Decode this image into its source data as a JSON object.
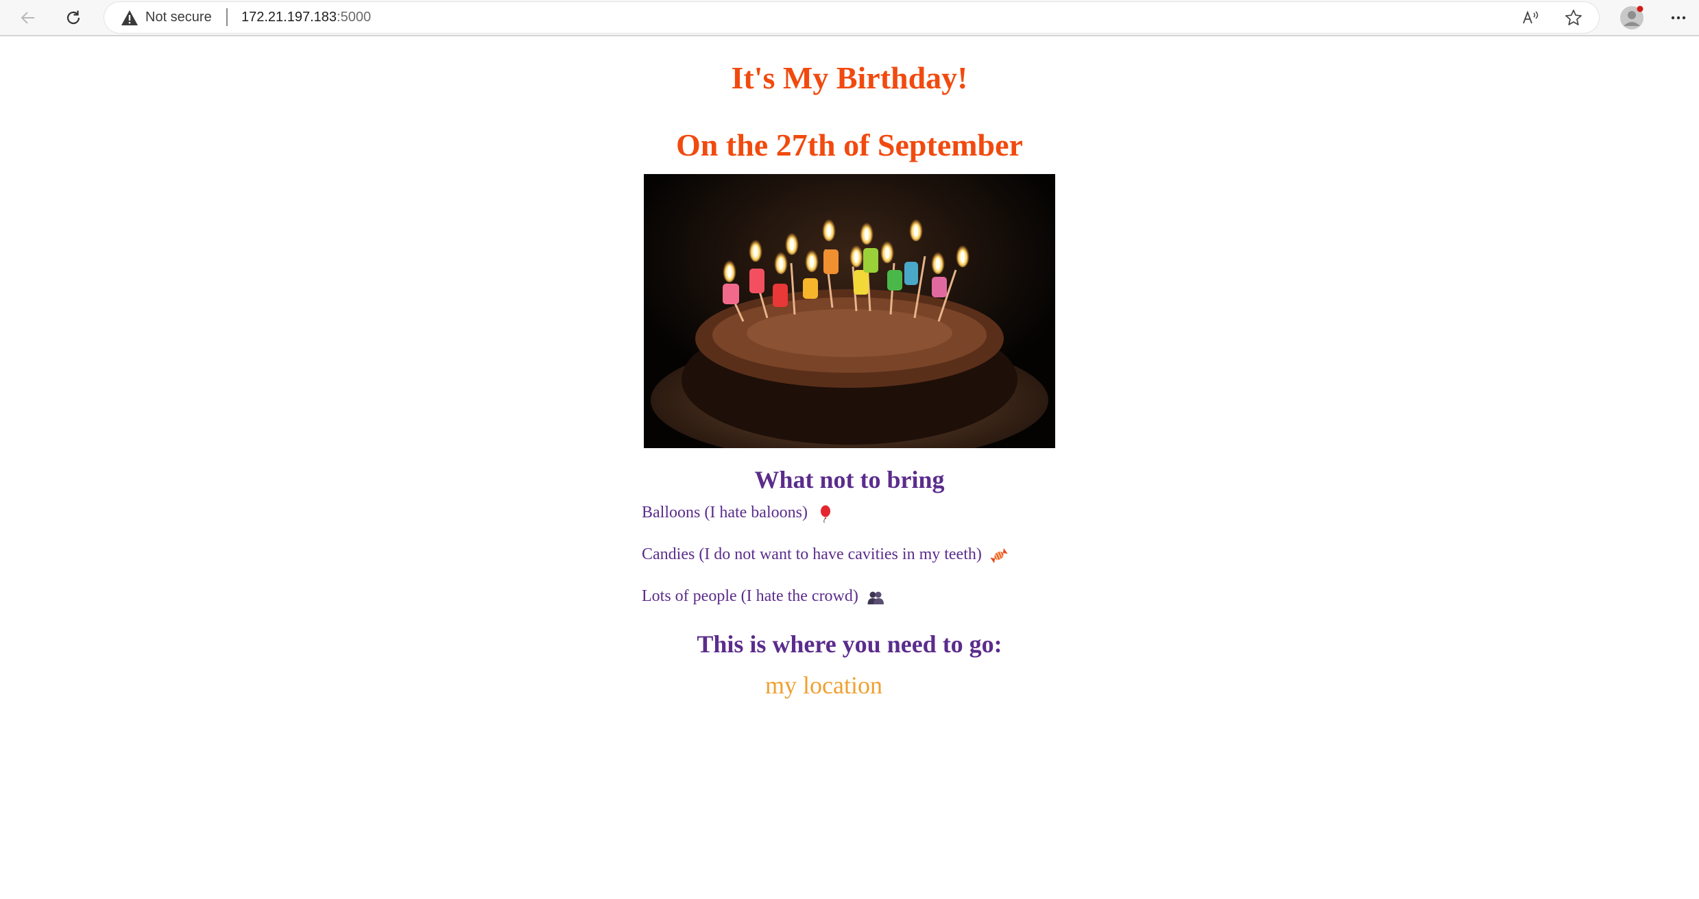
{
  "browser": {
    "security_label": "Not secure",
    "url_host": "172.21.197.183",
    "url_port": ":5000"
  },
  "page": {
    "title": "It's My Birthday!",
    "date_heading": "On the 27th of September",
    "what_not_heading": "What not to bring",
    "items": [
      {
        "label": "Balloons (I hate baloons)",
        "icon": "balloon-icon"
      },
      {
        "label": "Candies (I do not want to have cavities in my teeth)",
        "icon": "candy-icon"
      },
      {
        "label": "Lots of people (I hate the crowd)",
        "icon": "people-icon"
      }
    ],
    "where_heading": "This is where you need to go:",
    "location_link": "my location"
  },
  "colors": {
    "title": "#f14a0f",
    "headings": "#5b2c8c",
    "link": "#f0a030"
  }
}
